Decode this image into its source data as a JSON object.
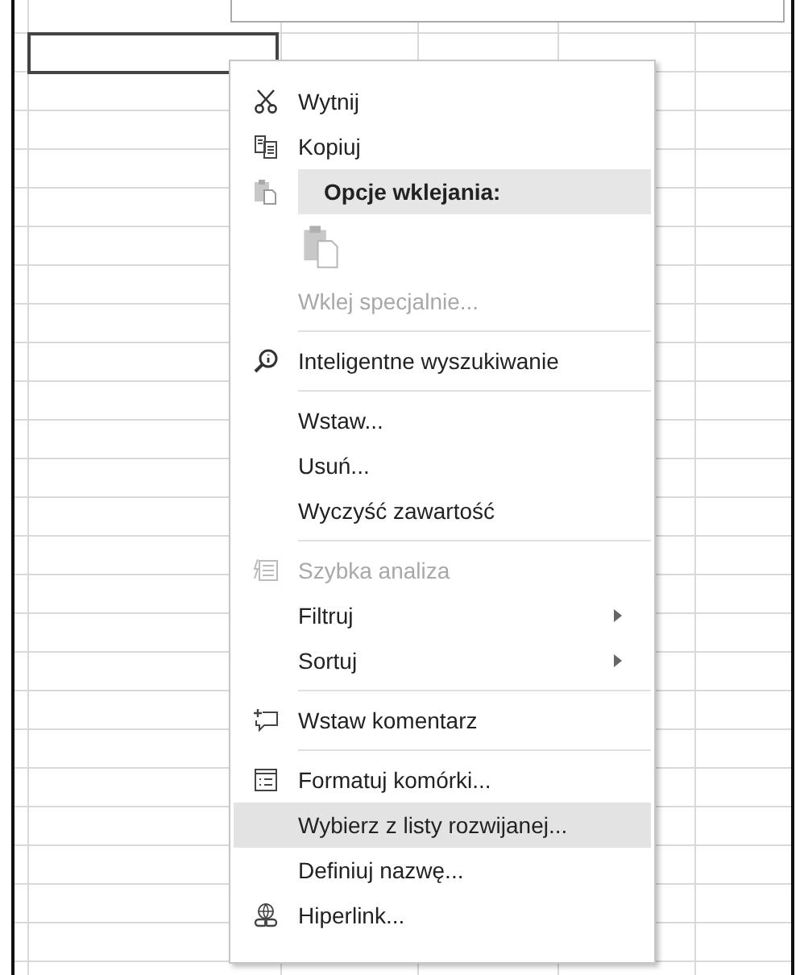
{
  "context_menu": {
    "items": [
      {
        "kind": "command",
        "label": "Wytnij",
        "disabled": false,
        "selected": false
      },
      {
        "kind": "command",
        "label": "Kopiuj",
        "disabled": false,
        "selected": false
      },
      {
        "kind": "header",
        "label": "Opcje wklejania:"
      },
      {
        "kind": "paste-options"
      },
      {
        "kind": "command",
        "label": "Wklej specjalnie...",
        "disabled": true,
        "selected": false
      },
      {
        "kind": "separator"
      },
      {
        "kind": "command",
        "label": "Inteligentne wyszukiwanie",
        "disabled": false,
        "selected": false
      },
      {
        "kind": "separator"
      },
      {
        "kind": "command",
        "label": "Wstaw...",
        "disabled": false,
        "selected": false
      },
      {
        "kind": "command",
        "label": "Usuń...",
        "disabled": false,
        "selected": false
      },
      {
        "kind": "command",
        "label": "Wyczyść zawartość",
        "disabled": false,
        "selected": false
      },
      {
        "kind": "separator"
      },
      {
        "kind": "command",
        "label": "Szybka analiza",
        "disabled": true,
        "selected": false
      },
      {
        "kind": "submenu",
        "label": "Filtruj",
        "disabled": false,
        "selected": false
      },
      {
        "kind": "submenu",
        "label": "Sortuj",
        "disabled": false,
        "selected": false
      },
      {
        "kind": "separator"
      },
      {
        "kind": "command",
        "label": "Wstaw komentarz",
        "disabled": false,
        "selected": false
      },
      {
        "kind": "separator"
      },
      {
        "kind": "command",
        "label": "Formatuj komórki...",
        "disabled": false,
        "selected": false
      },
      {
        "kind": "command",
        "label": "Wybierz z listy rozwijanej...",
        "disabled": false,
        "selected": true
      },
      {
        "kind": "command",
        "label": "Definiuj nazwę...",
        "disabled": false,
        "selected": false
      },
      {
        "kind": "command",
        "label": "Hiperlink...",
        "disabled": false,
        "selected": false
      }
    ]
  }
}
